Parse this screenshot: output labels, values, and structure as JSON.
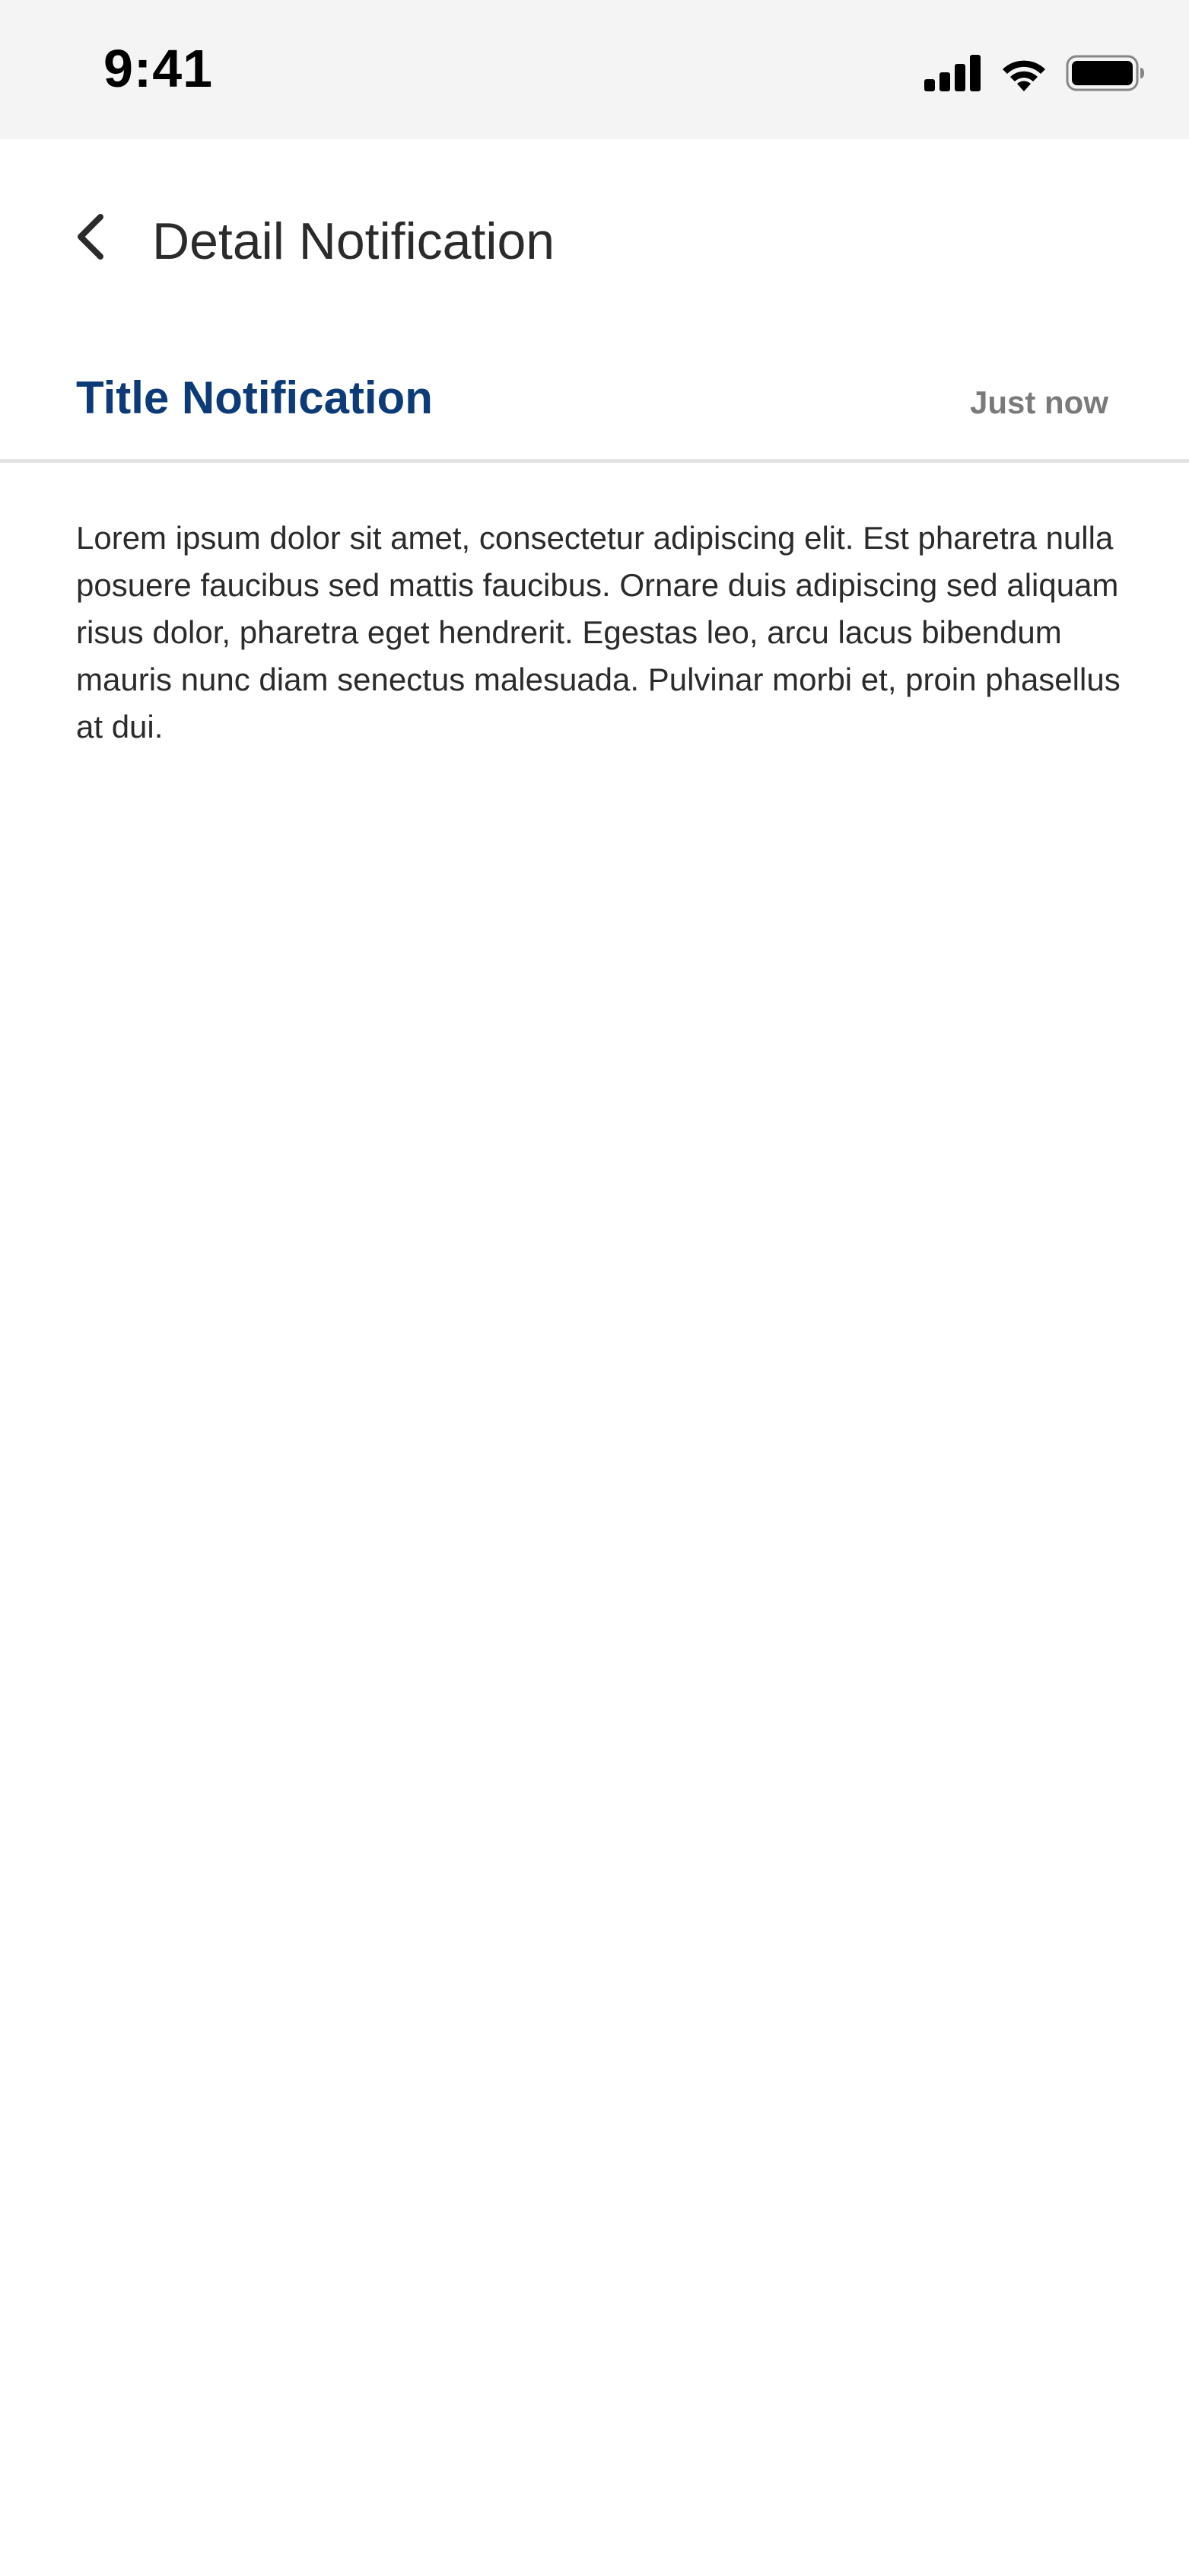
{
  "status_bar": {
    "time": "9:41",
    "icons": [
      "cellular-signal-icon",
      "wifi-icon",
      "battery-icon"
    ]
  },
  "nav": {
    "back_icon": "chevron-left-icon",
    "title": "Detail Notification"
  },
  "notification": {
    "title": "Title Notification",
    "time": "Just now",
    "body": "Lorem ipsum dolor sit amet, consectetur adipiscing elit. Est pharetra nulla posuere faucibus sed mattis faucibus. Ornare duis adipiscing sed aliquam risus dolor, pharetra eget hendrerit. Egestas leo, arcu lacus bibendum mauris nunc diam senectus malesuada. Pulvinar morbi et, proin phasellus at dui."
  },
  "colors": {
    "title_blue": "#0d3b78",
    "muted_gray": "#7a7a7a",
    "status_bar_bg": "#f4f4f4",
    "divider": "#e2e2e2"
  }
}
